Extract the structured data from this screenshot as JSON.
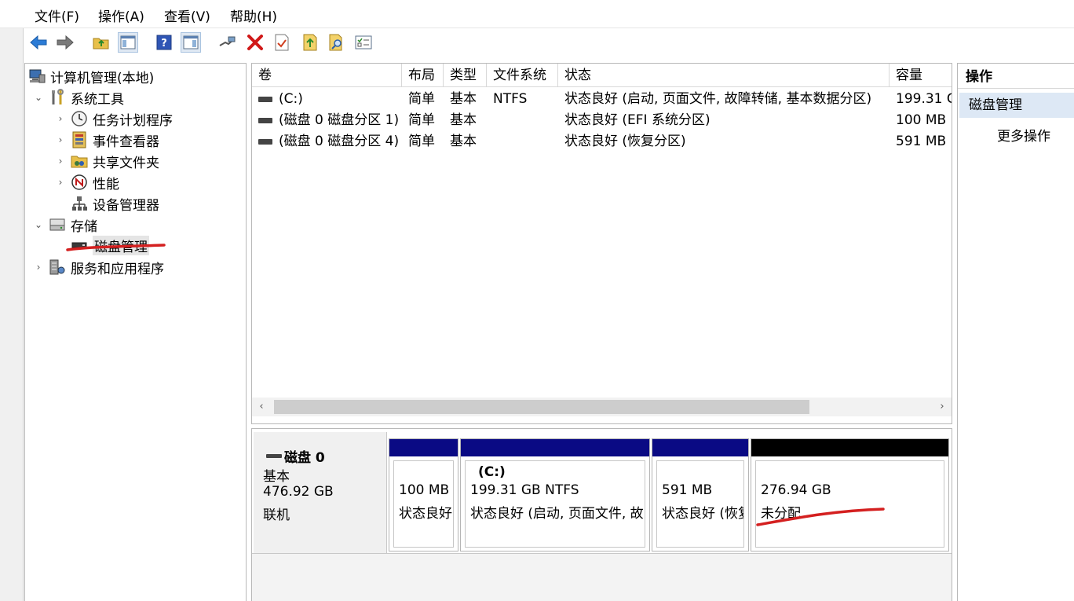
{
  "menu": [
    "文件(F)",
    "操作(A)",
    "查看(V)",
    "帮助(H)"
  ],
  "tree": {
    "root": "计算机管理(本地)",
    "system_tools": "系统工具",
    "task_scheduler": "任务计划程序",
    "event_viewer": "事件查看器",
    "shared_folders": "共享文件夹",
    "performance": "性能",
    "device_manager": "设备管理器",
    "storage": "存储",
    "disk_management": "磁盘管理",
    "services": "服务和应用程序"
  },
  "volume_list": {
    "columns": [
      "卷",
      "布局",
      "类型",
      "文件系统",
      "状态",
      "容量"
    ],
    "rows": [
      {
        "volume": "(C:)",
        "layout": "简单",
        "type": "基本",
        "fs": "NTFS",
        "status": "状态良好 (启动, 页面文件, 故障转储, 基本数据分区)",
        "capacity": "199.31 G"
      },
      {
        "volume": "(磁盘 0 磁盘分区 1)",
        "layout": "简单",
        "type": "基本",
        "fs": "",
        "status": "状态良好 (EFI 系统分区)",
        "capacity": "100 MB"
      },
      {
        "volume": "(磁盘 0 磁盘分区 4)",
        "layout": "简单",
        "type": "基本",
        "fs": "",
        "status": "状态良好 (恢复分区)",
        "capacity": "591 MB"
      }
    ]
  },
  "disk": {
    "name": "磁盘 0",
    "type": "基本",
    "size": "476.92 GB",
    "state": "联机",
    "partitions": [
      {
        "line1": "100 MB",
        "line2": "状态良好"
      },
      {
        "title": "(C:)",
        "line1": "199.31 GB NTFS",
        "line2": "状态良好 (启动, 页面文件, 故"
      },
      {
        "line1": "591 MB",
        "line2": "状态良好 (恢复"
      },
      {
        "line1": "276.94 GB",
        "line2": "未分配"
      }
    ]
  },
  "actions": {
    "header": "操作",
    "selected": "磁盘管理",
    "more": "更多操作"
  },
  "colors": {
    "primary_partition_bar": "#0a0a84",
    "unallocated_bar": "#000000",
    "annotation_red": "#d42020"
  }
}
